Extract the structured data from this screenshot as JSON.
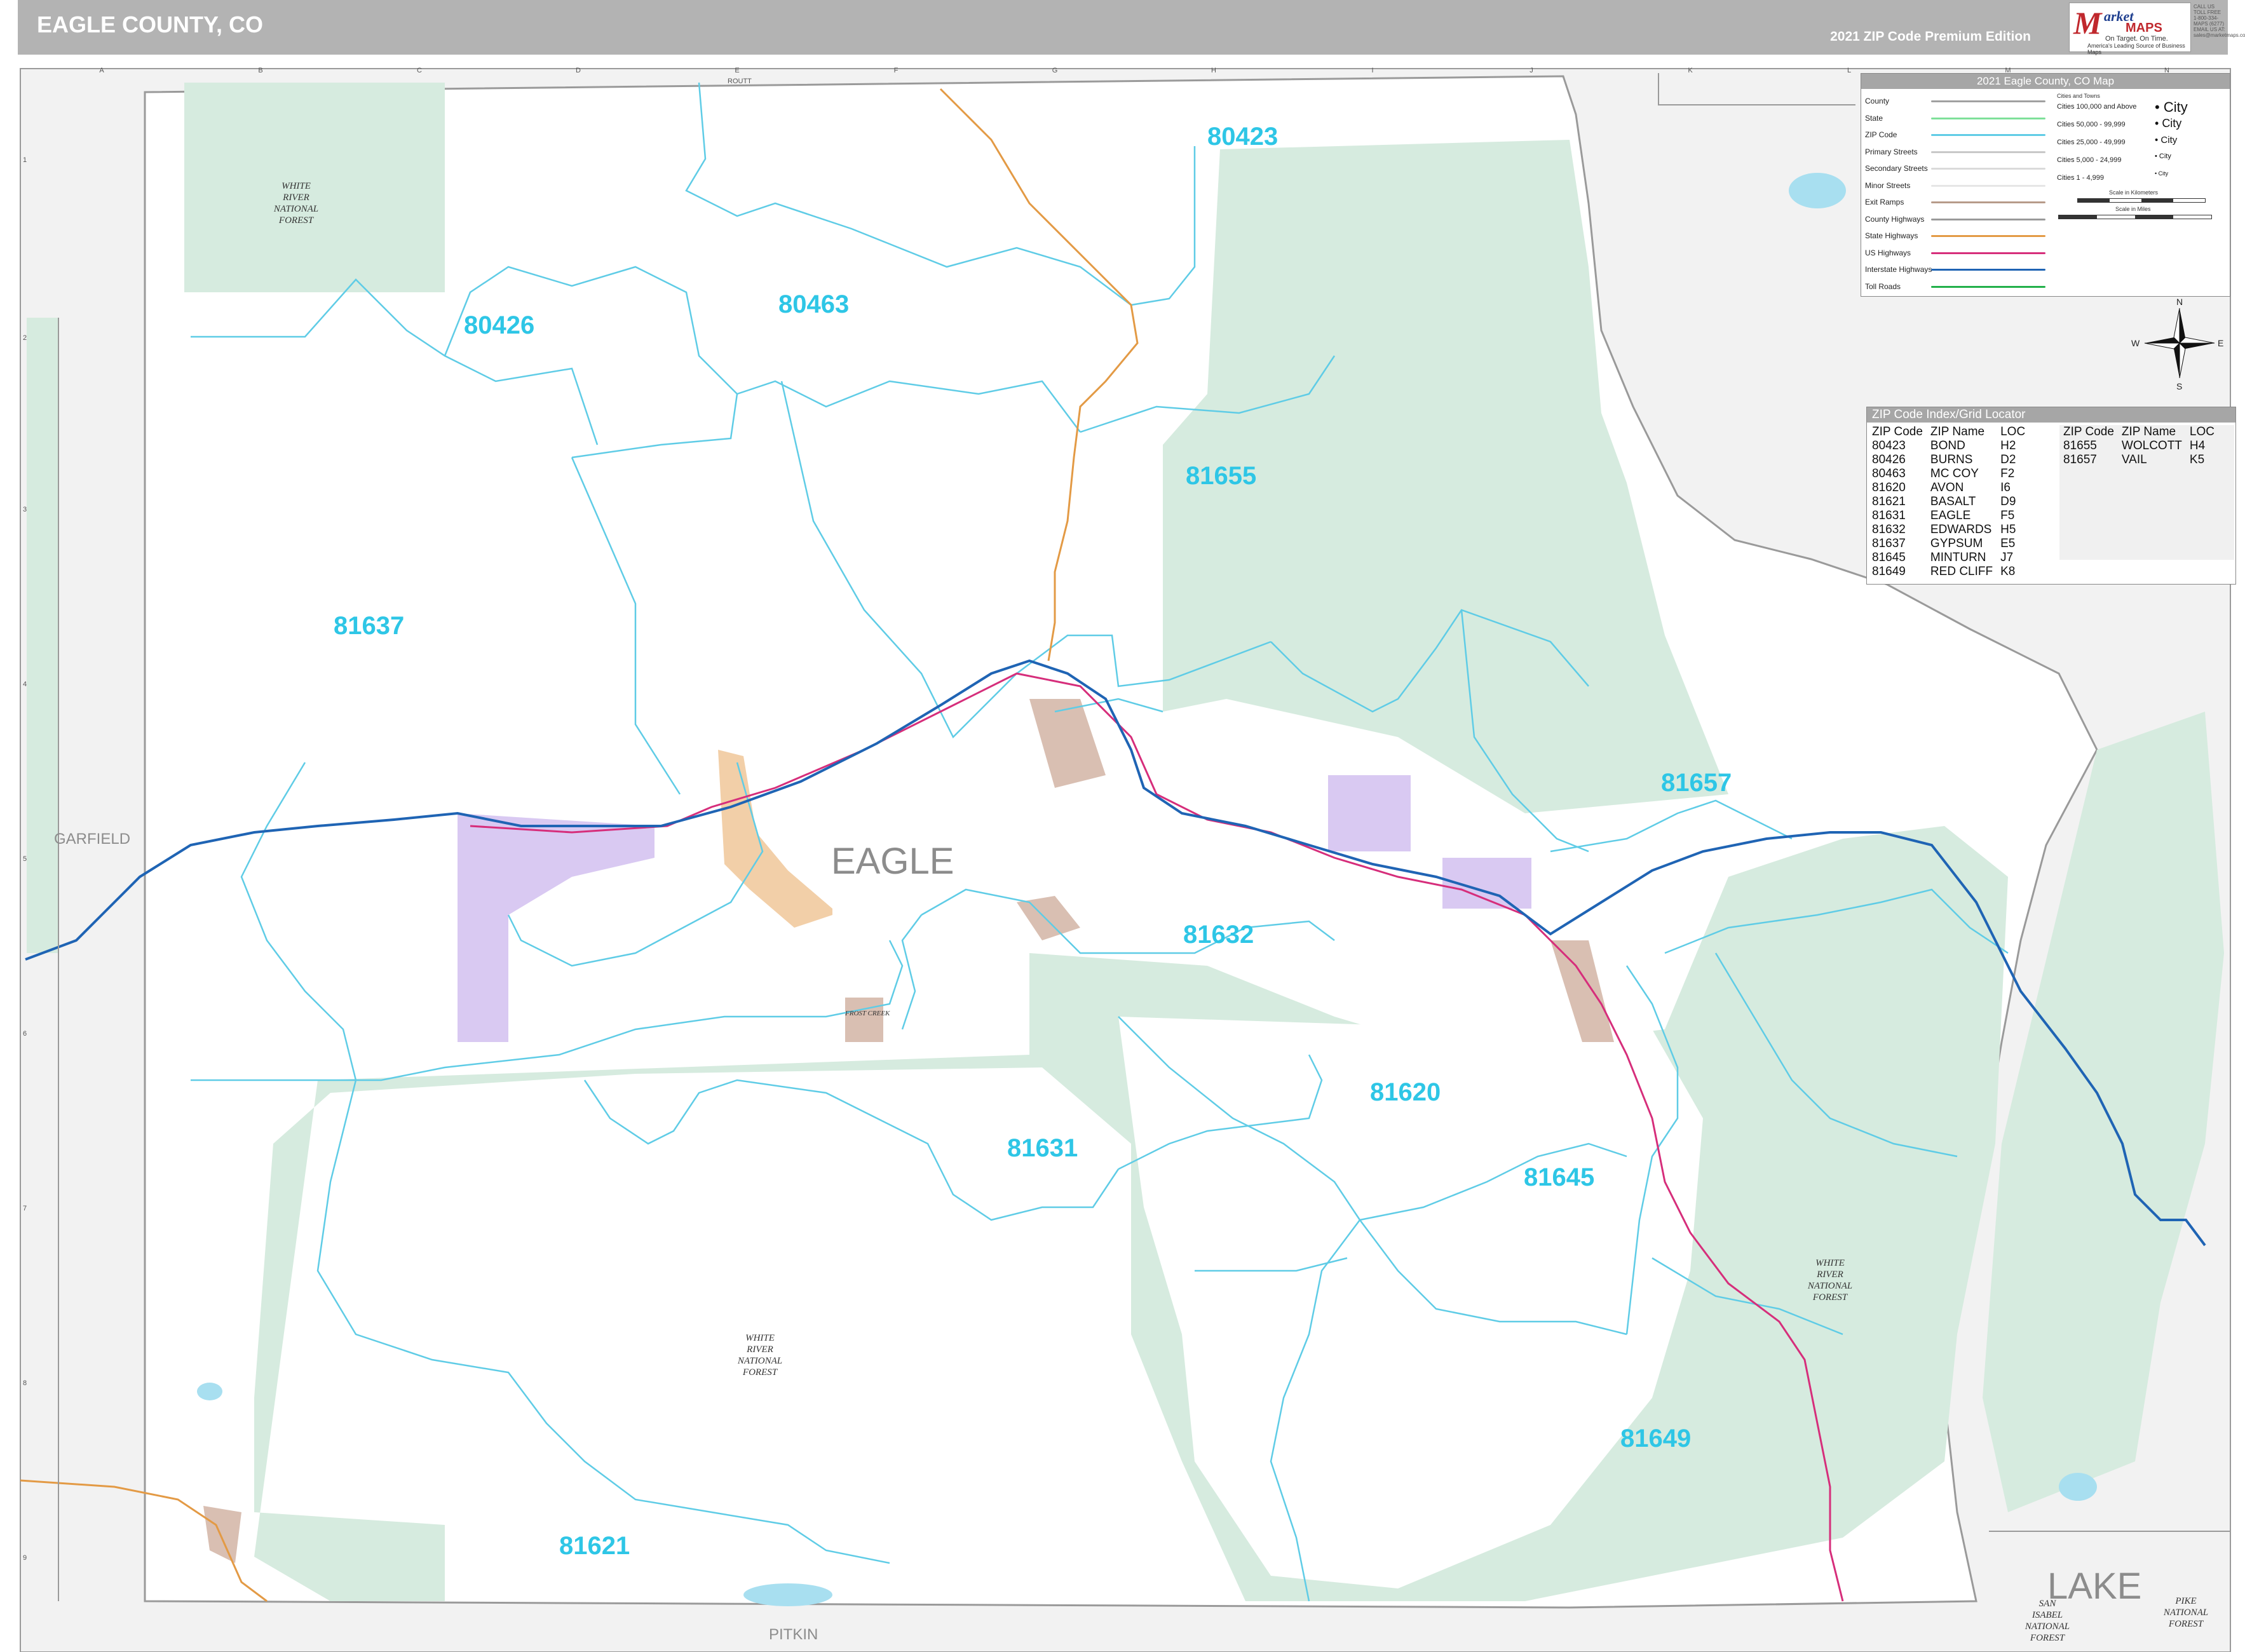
{
  "header": {
    "title": "EAGLE COUNTY, CO",
    "edition": "2021 ZIP Code Premium Edition"
  },
  "logo": {
    "mark": "M",
    "word_market": "arket",
    "word_maps": "MAPS",
    "tagline": "On Target. On Time.",
    "subtagline": "America's Leading Source of Business Maps",
    "contact": "CALL US TOLL FREE 1-800-334-MAPS (6277) EMAIL US AT: sales@marketmaps.com"
  },
  "map": {
    "county_label": "EAGLE",
    "neighbors": [
      {
        "name": "GARFIELD"
      },
      {
        "name": "PITKIN"
      },
      {
        "name": "LAKE"
      },
      {
        "name": "ROUTT"
      }
    ],
    "zip_labels": [
      {
        "code": "80423"
      },
      {
        "code": "80426"
      },
      {
        "code": "80463"
      },
      {
        "code": "81655"
      },
      {
        "code": "81637"
      },
      {
        "code": "81657"
      },
      {
        "code": "81632"
      },
      {
        "code": "81620"
      },
      {
        "code": "81631"
      },
      {
        "code": "81645"
      },
      {
        "code": "81649"
      },
      {
        "code": "81621"
      }
    ],
    "forest_labels": [
      {
        "lines": [
          "WHITE",
          "RIVER",
          "NATIONAL",
          "FOREST"
        ]
      },
      {
        "lines": [
          "WHITE",
          "RIVER",
          "NATIONAL",
          "FOREST"
        ]
      },
      {
        "lines": [
          "WHITE",
          "RIVER",
          "NATIONAL",
          "FOREST"
        ]
      },
      {
        "lines": [
          "SAN",
          "ISABEL",
          "NATIONAL",
          "FOREST"
        ]
      },
      {
        "lines": [
          "PIKE",
          "NATIONAL",
          "FOREST"
        ]
      }
    ],
    "town_labels": [
      "FROST CREEK"
    ],
    "grid_columns": [
      "A",
      "B",
      "C",
      "D",
      "E",
      "F",
      "G",
      "H",
      "I",
      "J",
      "K",
      "L",
      "M",
      "N"
    ],
    "grid_rows": [
      "1",
      "2",
      "3",
      "4",
      "5",
      "6",
      "7",
      "8",
      "9"
    ],
    "compass": [
      "N",
      "E",
      "S",
      "W"
    ],
    "colors": {
      "forest": "#d6ebdf",
      "zip_boundary": "#5fcce6",
      "interstate": "#1f64b4",
      "us_highway": "#d62e7b",
      "state_highway": "#e39a45",
      "place_purple": "#d9c9f2",
      "place_orange": "#f2cfa8",
      "place_brown": "#d9bfb2",
      "water": "#a8dff0",
      "outside_county": "#f2f2f2"
    }
  },
  "legend": {
    "title": "2021 Eagle County, CO Map",
    "items": [
      {
        "label": "County",
        "color": "#a0a0a0"
      },
      {
        "label": "State",
        "color": "#7ee09a"
      },
      {
        "label": "ZIP Code",
        "color": "#5fcce6"
      },
      {
        "label": "Primary Streets",
        "color": "#c8c8c8"
      },
      {
        "label": "Secondary Streets",
        "color": "#dadada"
      },
      {
        "label": "Minor Streets",
        "color": "#e6e6e6"
      },
      {
        "label": "Exit Ramps",
        "color": "#b79b8a"
      },
      {
        "label": "County Highways",
        "color": "#9a9a9a"
      },
      {
        "label": "State Highways",
        "color": "#e39a45"
      },
      {
        "label": "US Highways",
        "color": "#d62e7b"
      },
      {
        "label": "Interstate Highways",
        "color": "#1f64b4"
      },
      {
        "label": "Toll Roads",
        "color": "#22b04a"
      }
    ],
    "cities_heading": "Cities and Towns",
    "cities": [
      {
        "label": "Cities 100,000 and Above",
        "sample": "City"
      },
      {
        "label": "Cities 50,000 - 99,999",
        "sample": "City"
      },
      {
        "label": "Cities 25,000 - 49,999",
        "sample": "City"
      },
      {
        "label": "Cities 5,000 - 24,999",
        "sample": "City"
      },
      {
        "label": "Cities 1 - 4,999",
        "sample": "City"
      }
    ],
    "scale_km": "Scale in Kilometers",
    "scale_mi": "Scale in Miles"
  },
  "zip_index": {
    "title": "ZIP Code Index/Grid Locator",
    "headers": [
      "ZIP Code",
      "ZIP Name",
      "LOC"
    ],
    "left": [
      [
        "80423",
        "BOND",
        "H2"
      ],
      [
        "80426",
        "BURNS",
        "D2"
      ],
      [
        "80463",
        "MC COY",
        "F2"
      ],
      [
        "81620",
        "AVON",
        "I6"
      ],
      [
        "81621",
        "BASALT",
        "D9"
      ],
      [
        "81631",
        "EAGLE",
        "F5"
      ],
      [
        "81632",
        "EDWARDS",
        "H5"
      ],
      [
        "81637",
        "GYPSUM",
        "E5"
      ],
      [
        "81645",
        "MINTURN",
        "J7"
      ],
      [
        "81649",
        "RED CLIFF",
        "K8"
      ]
    ],
    "right": [
      [
        "81655",
        "WOLCOTT",
        "H4"
      ],
      [
        "81657",
        "VAIL",
        "K5"
      ]
    ]
  }
}
